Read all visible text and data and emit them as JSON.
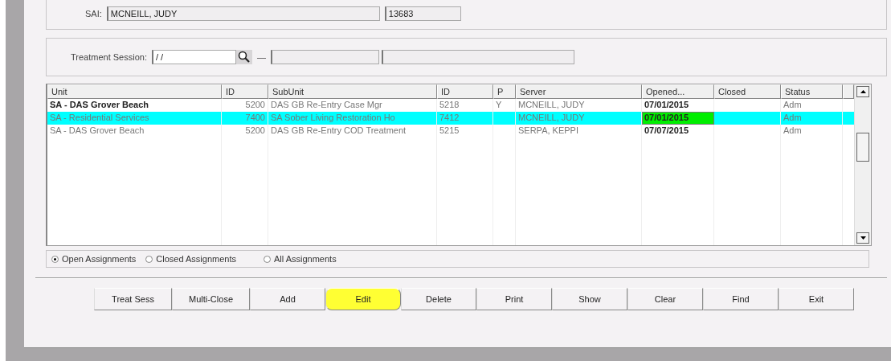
{
  "sai": {
    "label": "SAI:",
    "name": "MCNEILL, JUDY",
    "number": "13683"
  },
  "treatment_session": {
    "label": "Treatment Session:",
    "value": "/ /",
    "dash": "—"
  },
  "table": {
    "columns": [
      "Unit",
      "ID",
      "SubUnit",
      "ID",
      "P",
      "Server",
      "Opened...",
      "Closed",
      "Status"
    ],
    "rows": [
      {
        "selected": false,
        "bold": true,
        "date_highlight": false,
        "cells": [
          "SA - DAS Grover Beach",
          "5200",
          "DAS GB Re-Entry Case Mgr",
          "5218",
          "Y",
          "MCNEILL, JUDY",
          "07/01/2015",
          "",
          "Adm"
        ]
      },
      {
        "selected": true,
        "bold": false,
        "date_highlight": true,
        "cells": [
          "SA - Residential Services",
          "7400",
          "SA Sober Living Restoration Ho",
          "7412",
          "",
          "MCNEILL, JUDY",
          "07/01/2015",
          "",
          "Adm"
        ]
      },
      {
        "selected": false,
        "bold": false,
        "date_highlight": false,
        "cells": [
          "SA - DAS Grover Beach",
          "5200",
          "DAS GB Re-Entry COD Treatment",
          "5215",
          "",
          "SERPA, KEPPI",
          "07/07/2015",
          "",
          "Adm"
        ]
      }
    ]
  },
  "filters": [
    {
      "label": "Open Assignments",
      "selected": true
    },
    {
      "label": "Closed Assignments",
      "selected": false
    },
    {
      "label": "All Assignments",
      "selected": false
    }
  ],
  "buttons": [
    {
      "label": "Treat Sess",
      "highlighted": false
    },
    {
      "label": "Multi-Close",
      "highlighted": false
    },
    {
      "label": "Add",
      "highlighted": false
    },
    {
      "label": "Edit",
      "highlighted": true
    },
    {
      "label": "Delete",
      "highlighted": false
    },
    {
      "label": "Print",
      "highlighted": false
    },
    {
      "label": "Show",
      "highlighted": false
    },
    {
      "label": "Clear",
      "highlighted": false
    },
    {
      "label": "Find",
      "highlighted": false
    },
    {
      "label": "Exit",
      "highlighted": false
    }
  ]
}
